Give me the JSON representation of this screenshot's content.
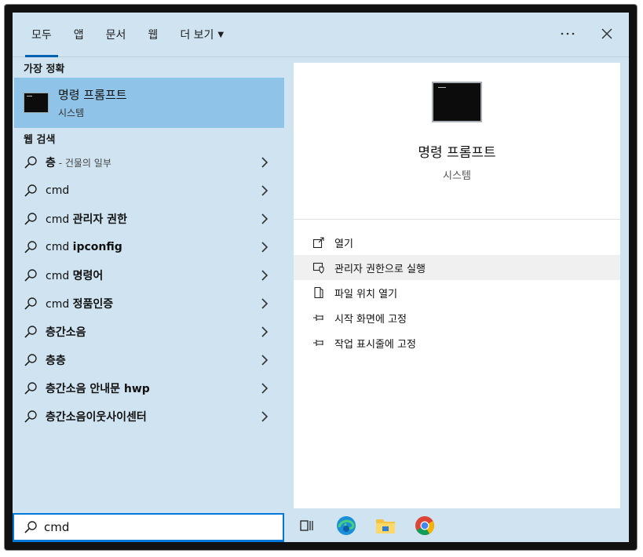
{
  "tabs": [
    {
      "label": "모두",
      "active": true
    },
    {
      "label": "앱"
    },
    {
      "label": "문서"
    },
    {
      "label": "웹"
    },
    {
      "label": "더 보기"
    }
  ],
  "header": {
    "more_icon": "ellipsis-icon",
    "close_icon": "close-icon"
  },
  "best_match": {
    "section_label": "가장 정확",
    "title": "명령 프롬프트",
    "subtitle": "시스템",
    "icon": "cmd-icon"
  },
  "web_search": {
    "section_label": "웹 검색",
    "items": [
      {
        "bold": "층",
        "rest": "",
        "hint": " - 건물의 일부"
      },
      {
        "bold": "",
        "rest": "cmd",
        "hint": ""
      },
      {
        "bold": "",
        "rest": "cmd ",
        "bold2": "관리자 권한"
      },
      {
        "bold": "",
        "rest": "cmd ",
        "bold2": "ipconfig"
      },
      {
        "bold": "",
        "rest": "cmd ",
        "bold2": "명령어"
      },
      {
        "bold": "",
        "rest": "cmd ",
        "bold2": "정품인증"
      },
      {
        "bold": "층간소음",
        "rest": ""
      },
      {
        "bold": "층층",
        "rest": ""
      },
      {
        "bold": "층간소음 안내문 hwp",
        "rest": ""
      },
      {
        "bold": "층간소음이웃사이센터",
        "rest": ""
      }
    ]
  },
  "preview": {
    "title": "명령 프롬프트",
    "subtitle": "시스템"
  },
  "actions": [
    {
      "label": "열기",
      "icon": "open-icon"
    },
    {
      "label": "관리자 권한으로 실행",
      "icon": "shield-icon"
    },
    {
      "label": "파일 위치 열기",
      "icon": "file-location-icon"
    },
    {
      "label": "시작 화면에 고정",
      "icon": "pin-icon"
    },
    {
      "label": "작업 표시줄에 고정",
      "icon": "pin-icon"
    }
  ],
  "search": {
    "value": "cmd"
  },
  "taskbar": [
    "task-view-icon",
    "edge-icon",
    "file-explorer-icon",
    "chrome-icon"
  ],
  "colors": {
    "accent": "#0063b1",
    "selected": "#8fc4e8",
    "pane_bg": "#cfe4f0"
  }
}
